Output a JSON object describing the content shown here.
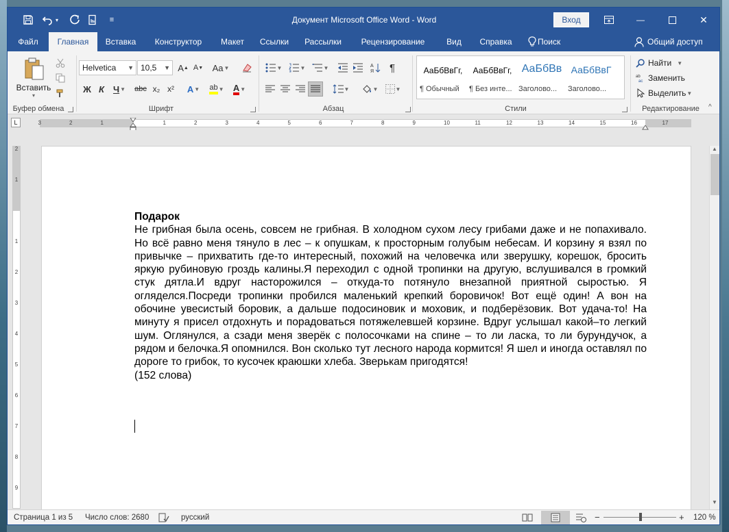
{
  "titlebar": {
    "title": "Документ Microsoft Office Word  -  Word",
    "signin": "Вход",
    "qat_caret": "▾",
    "qat_more": "≡",
    "minimize": "—",
    "close": "✕"
  },
  "tabs": [
    {
      "label": "Файл"
    },
    {
      "label": "Главная"
    },
    {
      "label": "Вставка"
    },
    {
      "label": "Конструктор"
    },
    {
      "label": "Макет"
    },
    {
      "label": "Ссылки"
    },
    {
      "label": "Рассылки"
    },
    {
      "label": "Рецензирование"
    },
    {
      "label": "Вид"
    },
    {
      "label": "Справка"
    },
    {
      "label": "Поиск"
    },
    {
      "label": "Общий доступ"
    }
  ],
  "ribbon": {
    "clipboard": {
      "paste": "Вставить",
      "group": "Буфер обмена"
    },
    "font": {
      "name": "Helvetica",
      "size": "10,5",
      "grow": "A",
      "shrink": "A",
      "case": "Aa",
      "bold": "Ж",
      "italic": "К",
      "underline": "Ч",
      "strike": "abc",
      "sub": "x₂",
      "sup": "x²",
      "effects": "A",
      "highlight": "ab",
      "color": "A",
      "group": "Шрифт"
    },
    "paragraph": {
      "pilcrow": "¶",
      "group": "Абзац"
    },
    "styles": {
      "items": [
        {
          "sample": "АаБбВвГг,",
          "name": "¶ Обычный"
        },
        {
          "sample": "АаБбВвГг,",
          "name": "¶ Без инте..."
        },
        {
          "sample": "АаБбВв",
          "name": "Заголово..."
        },
        {
          "sample": "АаБбВвГ",
          "name": "Заголово..."
        }
      ],
      "group": "Стили"
    },
    "editing": {
      "find": "Найти",
      "replace": "Заменить",
      "select": "Выделить",
      "group": "Редактирование"
    },
    "collapse": "^"
  },
  "ruler": {
    "tab_selector": "L",
    "ticks": [
      "3",
      "2",
      "1",
      "1",
      "2",
      "3",
      "4",
      "5",
      "6",
      "7",
      "8",
      "9",
      "10",
      "11",
      "12",
      "13",
      "14",
      "15",
      "16",
      "17"
    ],
    "vticks": [
      "2",
      "1",
      "1",
      "2",
      "3",
      "4",
      "5",
      "6",
      "7",
      "8",
      "9"
    ]
  },
  "document": {
    "heading": "Подарок",
    "body": "Не грибная была осень, совсем не грибная. В холодном сухом лесу грибами даже и не попахивало. Но всё равно меня тянуло в лес – к опушкам, к просторным голубым небесам. И корзину я взял по привычке – прихватить где-то интересный, похожий на человечка или зверушку, корешок, бросить яркую рубиновую гроздь калины.Я переходил с одной тропинки на другую, вслушивался в громкий стук дятла.И вдруг насторожился – откуда-то потянуло внезапной приятной сыростью. Я огляделся.Посреди тропинки пробился маленький крепкий боровичок! Вот ещё один! А вон на обочине увесистый боровик, а дальше подосиновик и моховик, и подберёзовик. Вот удача-то! На минуту я присел отдохнуть и порадоваться потяжелевшей корзине. Вдруг услышал какой–то легкий шум. Оглянулся, а сзади меня зверёк с полосочками на спине – то ли ласка, то ли бурундучок, а рядом и белочка.Я опомнился. Вон сколько тут лесного народа кормится! Я шел и иногда оставлял по дороге то грибок, то кусочек краюшки хлеба. Зверькам пригодятся!",
    "wordcount": "(152 слова)"
  },
  "status": {
    "page": "Страница 1 из 5",
    "words": "Число слов: 2680",
    "language": "русский",
    "zoom_minus": "−",
    "zoom_plus": "+",
    "zoom": "120 %",
    "zoom_value": 120
  },
  "colors": {
    "accent": "#2b579a",
    "ribbon": "#f3f3f3"
  }
}
